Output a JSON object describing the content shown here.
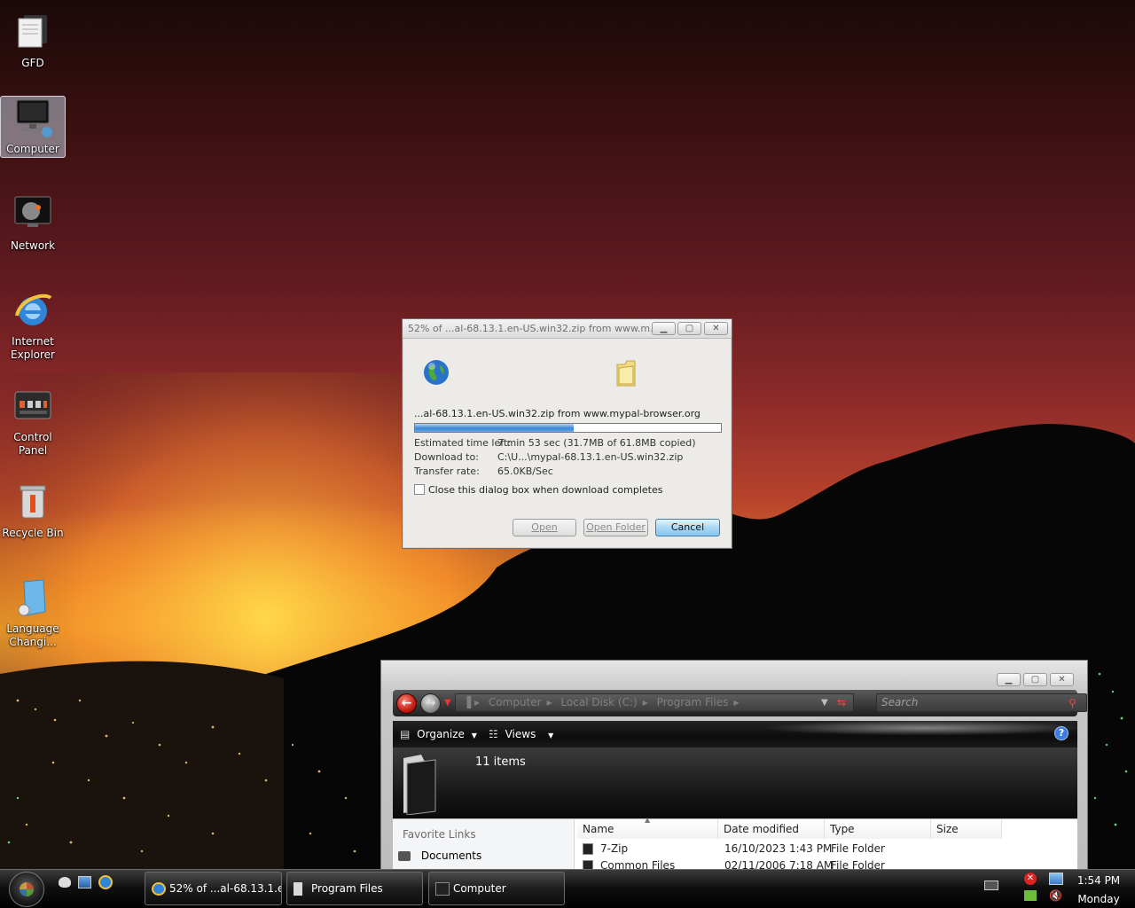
{
  "desktop": {
    "icons": [
      {
        "label": "GFD"
      },
      {
        "label": "Computer"
      },
      {
        "label": "Network"
      },
      {
        "label": "Internet Explorer"
      },
      {
        "label": "Control Panel"
      },
      {
        "label": "Recycle Bin"
      },
      {
        "label": "Language Changi..."
      }
    ]
  },
  "download_dialog": {
    "title": "52% of ...al-68.13.1.en-US.win32.zip from www.m...",
    "source_line": "...al-68.13.1.en-US.win32.zip from www.mypal-browser.org",
    "progress_percent": 52,
    "estimated_label": "Estimated time left:",
    "estimated_value": "7 min 53 sec (31.7MB of 61.8MB copied)",
    "download_to_label": "Download to:",
    "download_to_value": "C:\\U...\\mypal-68.13.1.en-US.win32.zip",
    "transfer_rate_label": "Transfer rate:",
    "transfer_rate_value": "65.0KB/Sec",
    "close_checkbox_label": "Close this dialog box when download completes",
    "close_checkbox_checked": false,
    "buttons": {
      "open": "Open",
      "open_folder": "Open Folder",
      "cancel": "Cancel"
    }
  },
  "explorer": {
    "breadcrumb": [
      "Computer",
      "Local Disk (C:)",
      "Program Files"
    ],
    "search_placeholder": "Search",
    "toolbar": {
      "organize": "Organize",
      "views": "Views"
    },
    "item_count": "11 items",
    "favorite_links_title": "Favorite Links",
    "favorite_links": [
      "Documents"
    ],
    "columns": [
      "Name",
      "Date modified",
      "Type",
      "Size"
    ],
    "rows": [
      {
        "name": "7-Zip",
        "date": "16/10/2023 1:43 PM",
        "type": "File Folder",
        "size": ""
      },
      {
        "name": "Common Files",
        "date": "02/11/2006 7:18 AM",
        "type": "File Folder",
        "size": ""
      }
    ]
  },
  "taskbar": {
    "buttons": [
      {
        "label": "52% of ...al-68.13.1.e..."
      },
      {
        "label": "Program Files"
      },
      {
        "label": "Computer"
      }
    ],
    "time": "1:54 PM",
    "day": "Monday"
  },
  "colors": {
    "accent_blue": "#3b86d6",
    "taskbar_black": "#000000",
    "back_button_red": "#c51d14"
  }
}
